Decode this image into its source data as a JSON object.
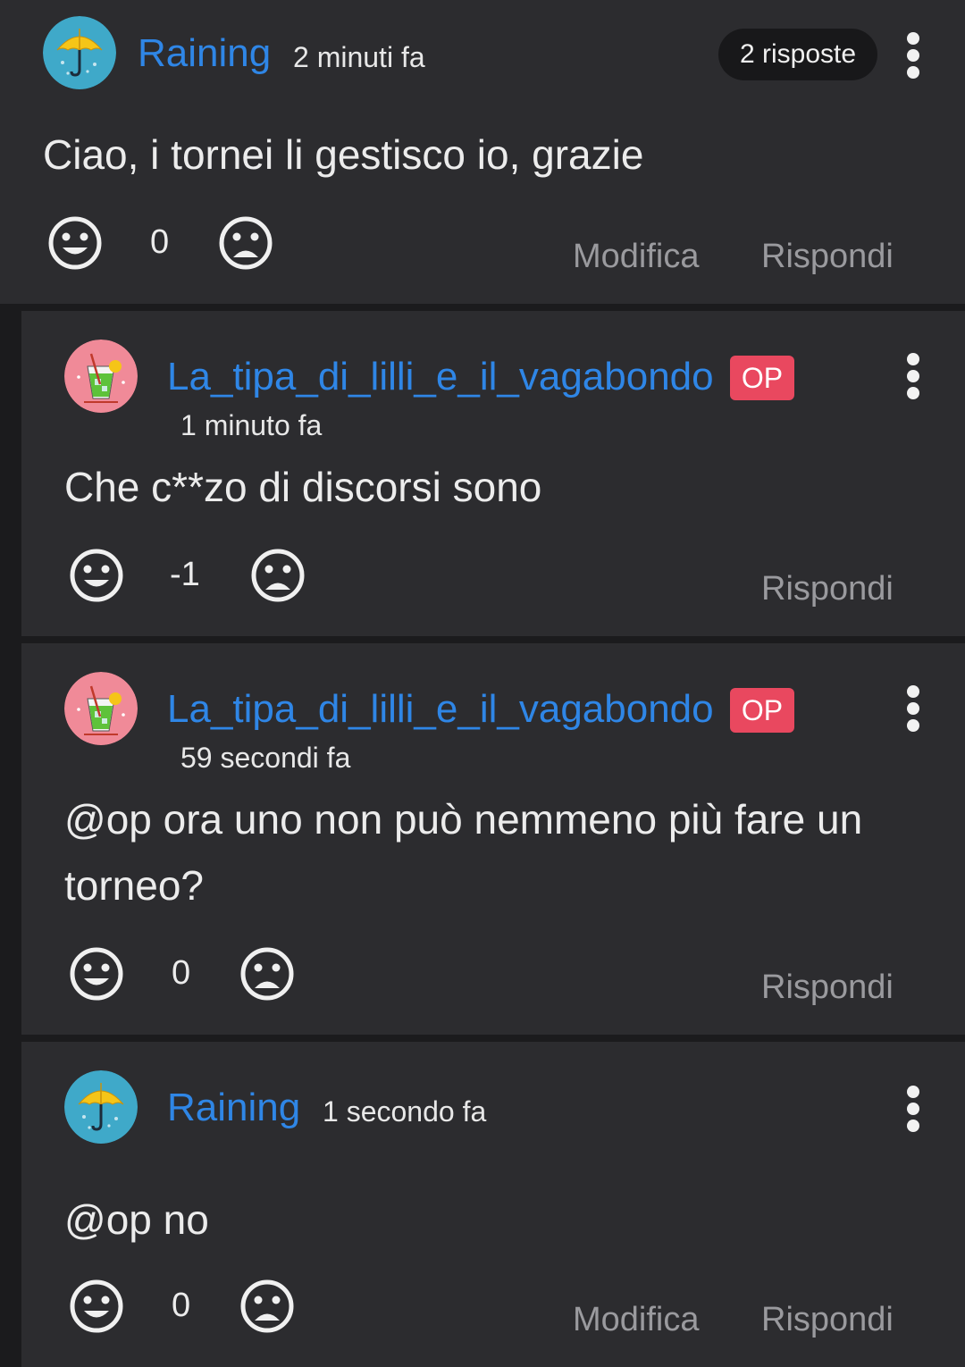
{
  "comments": [
    {
      "username": "Raining",
      "time": "2 minuti fa",
      "replies_badge": "2 risposte",
      "text": "Ciao, i tornei li gestisco io, grazie",
      "score": "0",
      "actions": {
        "edit": "Modifica",
        "reply": "Rispondi"
      }
    },
    {
      "username": "La_tipa_di_lilli_e_il_vagabondo",
      "badge": "OP",
      "time": "1 minuto fa",
      "text": "Che c**zo di discorsi sono",
      "score": "-1",
      "actions": {
        "reply": "Rispondi"
      }
    },
    {
      "username": "La_tipa_di_lilli_e_il_vagabondo",
      "badge": "OP",
      "time": "59 secondi fa",
      "text": "@op ora uno non può nemmeno più fare un torneo?",
      "score": "0",
      "actions": {
        "reply": "Rispondi"
      }
    },
    {
      "username": "Raining",
      "time": "1 secondo fa",
      "text": "@op no",
      "score": "0",
      "actions": {
        "edit": "Modifica",
        "reply": "Rispondi"
      }
    }
  ],
  "colors": {
    "background": "#1b1b1d",
    "card": "#2c2c2f",
    "username": "#2f86e6",
    "op_badge": "#e9485f",
    "action_text": "#9a9a9e"
  },
  "icons": {
    "avatar_raining": "umbrella-icon",
    "avatar_op": "cocktail-icon",
    "upvote": "smile-face-icon",
    "downvote": "sad-face-icon",
    "menu": "kebab-menu-icon"
  }
}
